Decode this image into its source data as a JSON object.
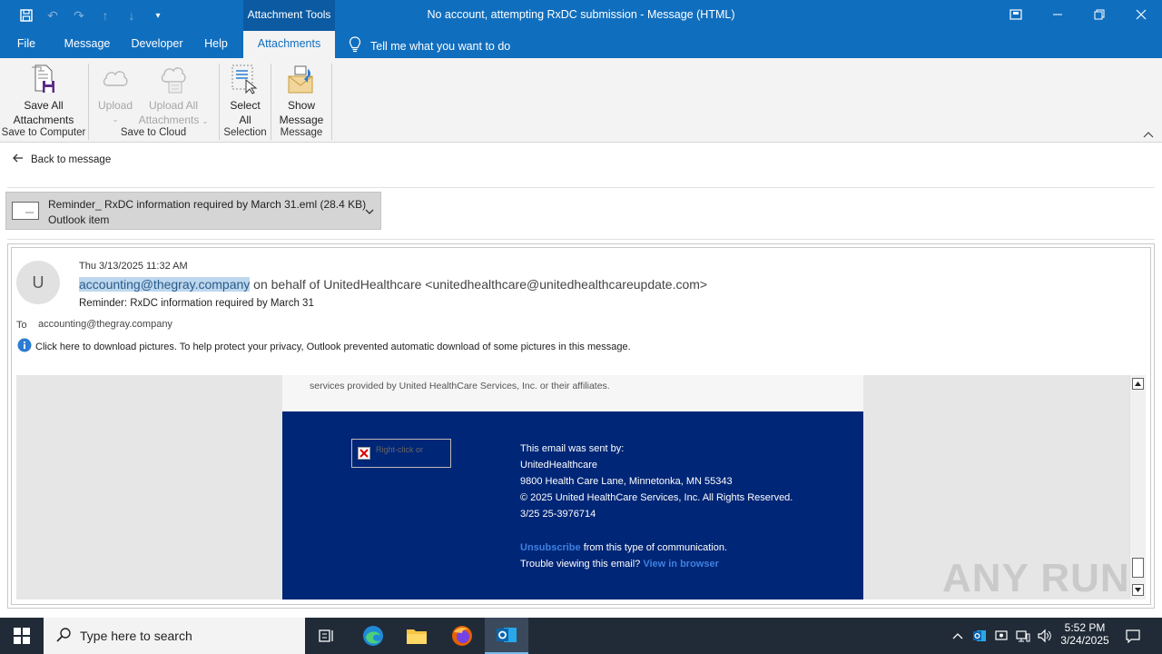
{
  "window": {
    "title": "No account, attempting RxDC submission  -  Message (HTML)",
    "tools_label": "Attachment Tools"
  },
  "tabs": [
    {
      "label": "File"
    },
    {
      "label": "Message"
    },
    {
      "label": "Developer"
    },
    {
      "label": "Help"
    },
    {
      "label": "Attachments"
    }
  ],
  "tell_me": "Tell me what you want to do",
  "ribbon": {
    "save_all": [
      "Save All",
      "Attachments"
    ],
    "upload": "Upload",
    "upload_all": [
      "Upload All",
      "Attachments"
    ],
    "select_all": [
      "Select",
      "All"
    ],
    "show_message": [
      "Show",
      "Message"
    ],
    "groups": [
      "Save to Computer",
      "Save to Cloud",
      "Selection",
      "Message"
    ]
  },
  "back_link": "Back to message",
  "attachment": {
    "name": "Reminder_ RxDC information required by March 31.eml (28.4 KB)",
    "type": "Outlook item"
  },
  "email": {
    "avatar_initial": "U",
    "date": "Thu 3/13/2025 11:32 AM",
    "from_highlight": "accounting@thegray.company",
    "from_rest": " on behalf of UnitedHealthcare <unitedhealthcare@unitedhealthcareupdate.com>",
    "subject": "Reminder: RxDC information required by March 31",
    "to_label": "To",
    "to": "accounting@thegray.company",
    "info_bar": "Click here to download pictures. To help protect your privacy, Outlook prevented automatic download of some pictures in this message."
  },
  "body": {
    "top_line": "services provided by United HealthCare Services, Inc. or their affiliates.",
    "broken_image_alt": "Right-click or",
    "footer_lines": [
      "This email was sent by:",
      "UnitedHealthcare",
      "9800 Health Care Lane, Minnetonka, MN 55343",
      "© 2025 United HealthCare Services, Inc. All Rights Reserved.",
      "3/25 25-3976714"
    ],
    "unsubscribe_link": "Unsubscribe",
    "unsubscribe_rest": " from this type of communication.",
    "trouble_text": "Trouble viewing this email? ",
    "view_browser_link": "View in browser"
  },
  "watermark": "ANY RUN",
  "taskbar": {
    "search_placeholder": "Type here to search",
    "time": "5:52 PM",
    "date": "3/24/2025"
  },
  "colors": {
    "accent": "#106ebe",
    "footer_blue": "#002677",
    "link_blue": "#3e80e0",
    "taskbar": "#202b37"
  }
}
